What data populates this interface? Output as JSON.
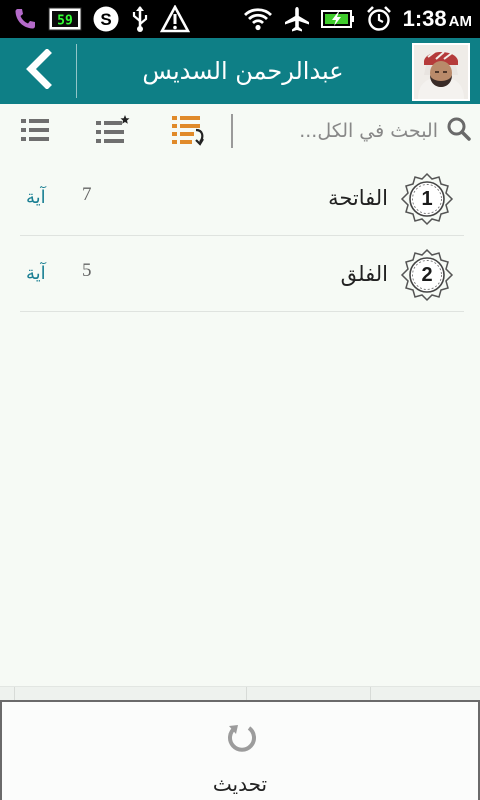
{
  "status_bar": {
    "battery_indicator": "59",
    "time": "1:38",
    "ampm": "AM",
    "icons": [
      "phone-icon",
      "battery-app-icon",
      "skype-icon",
      "usb-icon",
      "warning-icon",
      "wifi-icon",
      "airplane-icon",
      "battery-charging-icon",
      "alarm-icon"
    ]
  },
  "header": {
    "title": "عبدالرحمن السديس",
    "back_icon": "chevron-left-icon",
    "avatar": "reciter-avatar",
    "color": "#0e7f86"
  },
  "toolbar": {
    "search_placeholder": "البحث في الكل...",
    "buttons": [
      "list-icon",
      "favorites-list-icon",
      "playlist-icon"
    ],
    "active_color": "#e08a2a"
  },
  "surahs": [
    {
      "number": "1",
      "name": "الفاتحة",
      "count": "7",
      "unit": "آية"
    },
    {
      "number": "2",
      "name": "الفلق",
      "count": "5",
      "unit": "آية"
    }
  ],
  "refresh": {
    "label": "تحديث",
    "icon": "refresh-icon"
  }
}
